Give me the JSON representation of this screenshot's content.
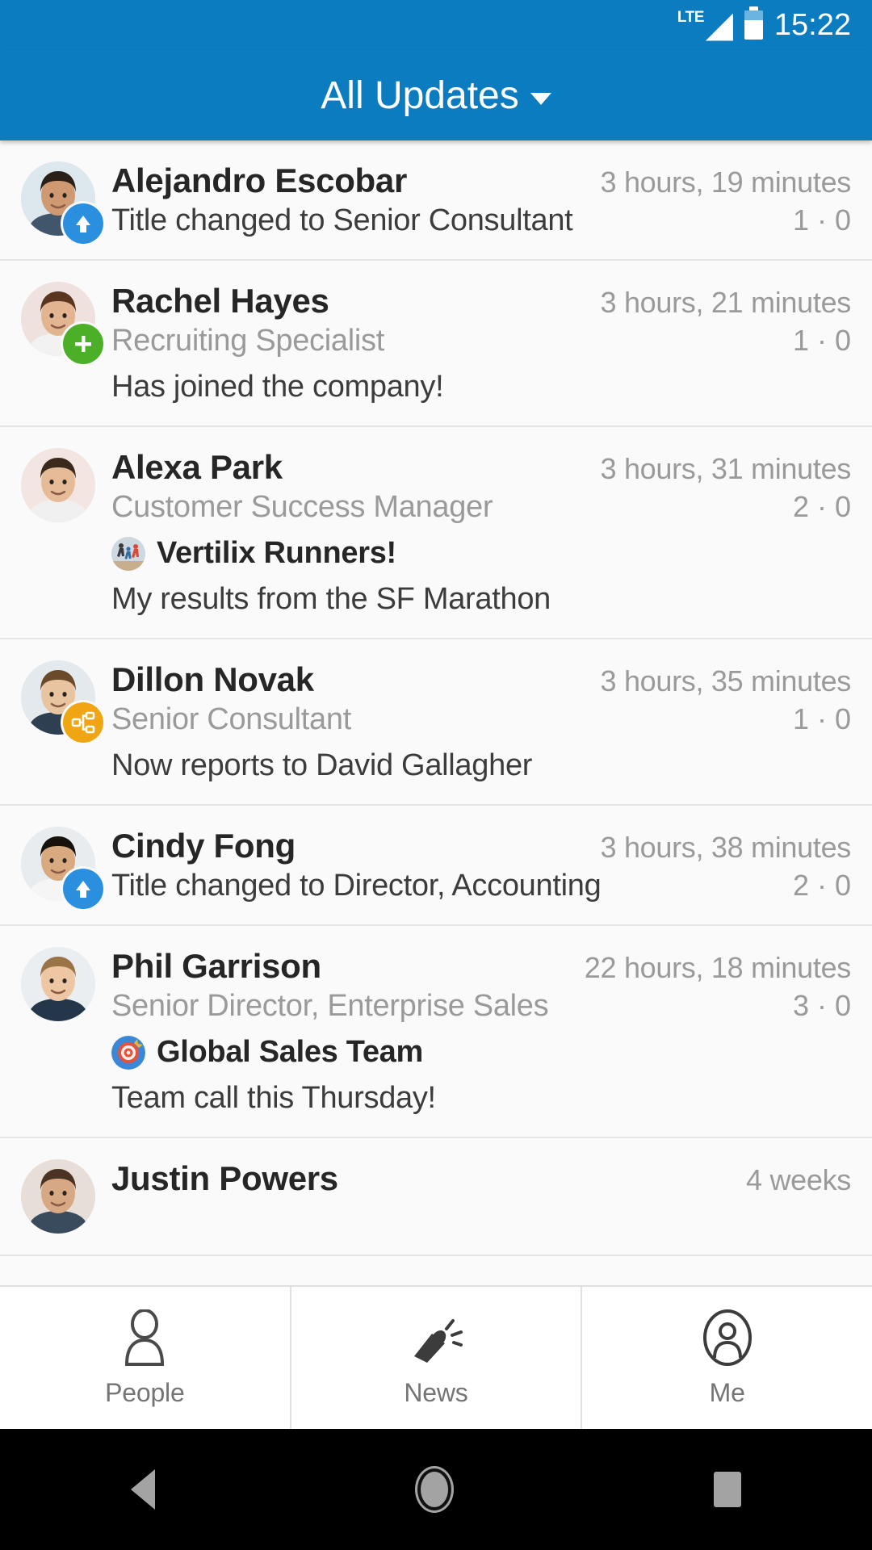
{
  "status_bar": {
    "network_label": "LTE",
    "time": "15:22",
    "signal_icon": "signal-bars-icon",
    "battery_icon": "battery-icon"
  },
  "header": {
    "title": "All Updates",
    "dropdown_icon": "chevron-down-icon",
    "background_color": "#0c7cc0"
  },
  "feed": {
    "items": [
      {
        "name": "Alejandro Escobar",
        "time": "3 hours, 19 minutes",
        "title": "",
        "counts": "1 · 0",
        "message": "Title changed to Senior Consultant",
        "badge": "promotion-arrow-badge",
        "badge_color": "#2b8fe0",
        "layout": "inline",
        "group": null
      },
      {
        "name": "Rachel Hayes",
        "time": "3 hours, 21 minutes",
        "title": "Recruiting Specialist",
        "counts": "1 · 0",
        "message": "Has joined the company!",
        "badge": "new-hire-plus-badge",
        "badge_color": "#4caf28",
        "layout": "stacked",
        "group": null
      },
      {
        "name": "Alexa Park",
        "time": "3 hours, 31 minutes",
        "title": "Customer Success Manager",
        "counts": "2 · 0",
        "message": "My results from the SF Marathon",
        "badge": null,
        "badge_color": "",
        "layout": "stacked",
        "group": {
          "name": "Vertilix Runners!",
          "icon": "runners-group-icon"
        }
      },
      {
        "name": "Dillon Novak",
        "time": "3 hours, 35 minutes",
        "title": "Senior Consultant",
        "counts": "1 · 0",
        "message": "Now reports to David Gallagher",
        "badge": "org-chart-badge",
        "badge_color": "#f0a612",
        "layout": "stacked",
        "group": null
      },
      {
        "name": "Cindy Fong",
        "time": "3 hours, 38 minutes",
        "title": "",
        "counts": "2 · 0",
        "message": "Title changed to Director, Accounting",
        "badge": "promotion-arrow-badge",
        "badge_color": "#2b8fe0",
        "layout": "inline",
        "group": null
      },
      {
        "name": "Phil Garrison",
        "time": "22 hours, 18 minutes",
        "title": "Senior Director, Enterprise Sales",
        "counts": "3 · 0",
        "message": "Team call this Thursday!",
        "badge": null,
        "badge_color": "",
        "layout": "stacked",
        "group": {
          "name": "Global Sales Team",
          "icon": "target-group-icon"
        }
      },
      {
        "name": "Justin Powers",
        "time": "4 weeks",
        "title": "",
        "counts": "",
        "message": "",
        "badge": null,
        "badge_color": "",
        "layout": "inline",
        "group": null
      }
    ]
  },
  "bottom_nav": {
    "items": [
      {
        "label": "People",
        "icon": "person-outline-icon"
      },
      {
        "label": "News",
        "icon": "megaphone-icon"
      },
      {
        "label": "Me",
        "icon": "person-circle-icon"
      }
    ]
  },
  "system_nav": {
    "back": "back-triangle-icon",
    "home": "home-circle-icon",
    "recents": "recents-square-icon"
  }
}
